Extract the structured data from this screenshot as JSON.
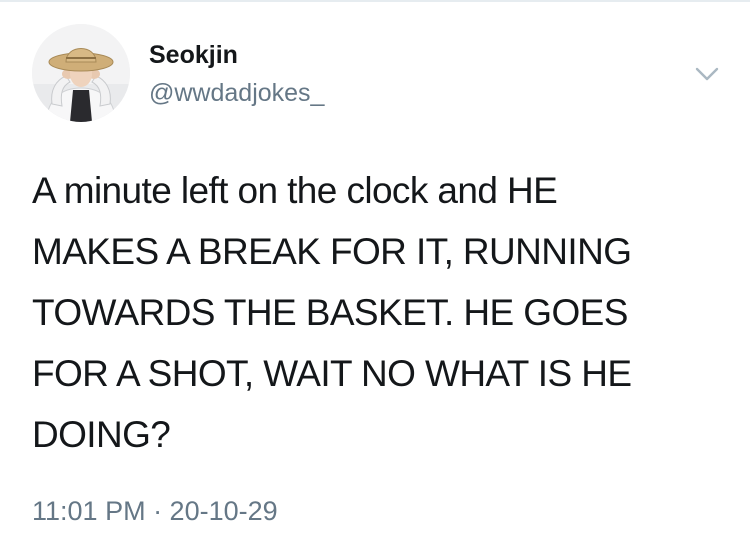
{
  "tweet": {
    "author": {
      "display_name": "Seokjin",
      "handle": "@wwdadjokes_",
      "avatar_icon": "profile-photo"
    },
    "text": "A minute left on the clock and HE\nMAKES A BREAK FOR IT, RUNNING\nTOWARDS THE BASKET. HE GOES\nFOR A SHOT, WAIT NO WHAT IS HE\nDOING?",
    "timestamp": "11:01 PM · 20-10-29",
    "menu_icon": "chevron-down-icon"
  },
  "colors": {
    "text_primary": "#14171a",
    "text_secondary": "#657786",
    "divider": "#e6ecf0",
    "chevron": "#aab8c2"
  }
}
